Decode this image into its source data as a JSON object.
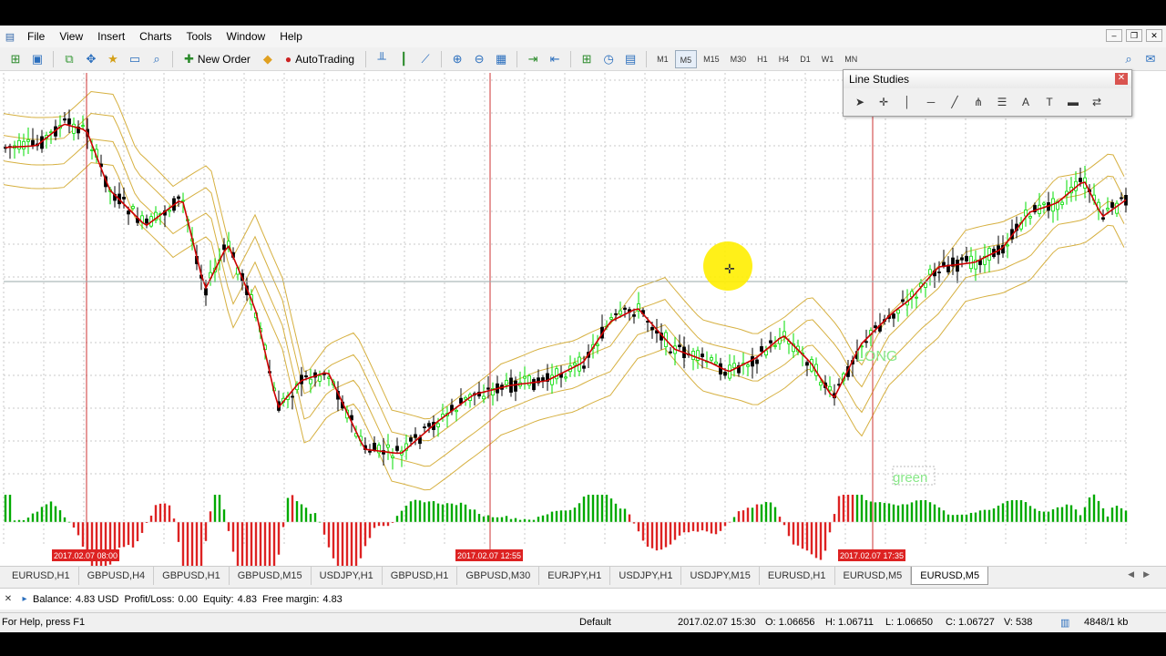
{
  "menu": [
    "File",
    "View",
    "Insert",
    "Charts",
    "Tools",
    "Window",
    "Help"
  ],
  "toolbar": {
    "new_order": "New Order",
    "autotrading": "AutoTrading",
    "timeframes": [
      "M1",
      "M5",
      "M15",
      "M30",
      "H1",
      "H4",
      "D1",
      "W1",
      "MN"
    ],
    "active_timeframe": "M5"
  },
  "line_studies": {
    "title": "Line Studies",
    "tools": [
      "cursor-icon",
      "crosshair-icon",
      "vertical-line-icon",
      "horizontal-line-icon",
      "trendline-icon",
      "andrews-pitchfork-icon",
      "fibonacci-icon",
      "text-icon",
      "text-label-icon",
      "arrow-icon",
      "more-icon"
    ]
  },
  "chart": {
    "annotations": {
      "long": "LONG",
      "green": "green"
    },
    "time_labels": [
      "2017.02.07 08:00",
      "2017.02.07 12:55",
      "2017.02.07 17:35"
    ],
    "colors": {
      "bull": "#00dd00",
      "bear": "#000000",
      "ma": "#cc0000",
      "bands": "#d6b040",
      "histo_up": "#00aa00",
      "histo_down": "#dd2222",
      "vline": "#cc3333",
      "highlight": "#ffee00"
    }
  },
  "tabs": [
    "EURUSD,H1",
    "GBPUSD,H4",
    "GBPUSD,H1",
    "GBPUSD,M15",
    "USDJPY,H1",
    "GBPUSD,H1",
    "GBPUSD,M30",
    "EURJPY,H1",
    "USDJPY,H1",
    "USDJPY,M15",
    "EURUSD,H1",
    "EURUSD,M5",
    "EURUSD,M5"
  ],
  "active_tab": 12,
  "terminal": {
    "balance_label": "Balance:",
    "balance": "4.83 USD",
    "pl_label": "Profit/Loss:",
    "pl": "0.00",
    "equity_label": "Equity:",
    "equity": "4.83",
    "margin_label": "Free margin:",
    "margin": "4.83"
  },
  "status": {
    "help": "For Help, press F1",
    "profile": "Default",
    "datetime": "2017.02.07 15:30",
    "open": "O: 1.06656",
    "high": "H: 1.06711",
    "low": "L: 1.06650",
    "close": "C: 1.06727",
    "volume": "V: 538",
    "traffic": "4848/1 kb"
  }
}
